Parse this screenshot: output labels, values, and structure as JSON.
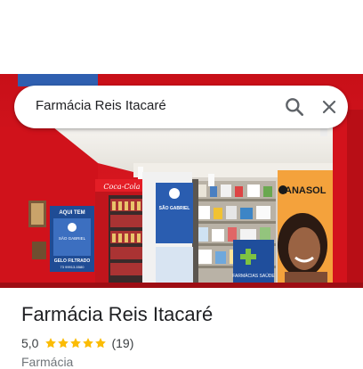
{
  "search": {
    "query": "Farmácia Reis Itacaré"
  },
  "photo": {
    "signs": {
      "aqui_tem": "AQUI TEM",
      "brand": "SÃO GABRIEL",
      "gelo": "GELO FILTRADO",
      "phone": "73 99913-5580",
      "fridge_brand": "Coca-Cola",
      "anasol": "ANASOL",
      "pharmacy_sign": "FARMÁCIAS SAÚDE"
    }
  },
  "place": {
    "name": "Farmácia Reis Itacaré",
    "rating": "5,0",
    "rating_value": 5.0,
    "stars_total": 5,
    "review_count": "(19)",
    "category": "Farmácia"
  },
  "colors": {
    "star": "#fbbc04",
    "wall_red": "#e0141e",
    "text_primary": "#202124",
    "text_secondary": "#70757a"
  }
}
